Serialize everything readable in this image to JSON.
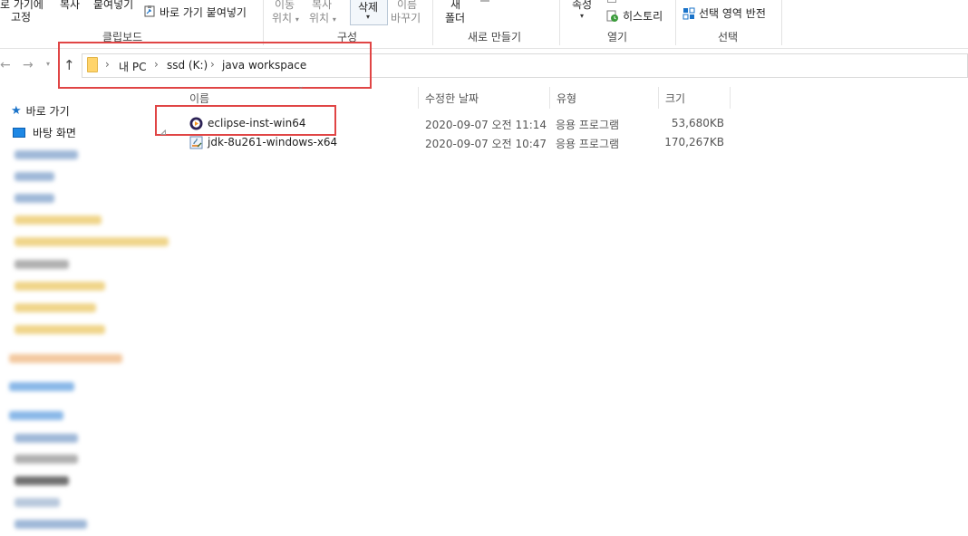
{
  "ribbon": {
    "pin_quick_access_line1": "로 가기에",
    "pin_quick_access_line2": "고정",
    "copy": "복사",
    "paste": "붙여넣기",
    "paste_shortcut": "바로 가기 붙여넣기",
    "move_to_line1": "이동",
    "move_to_line2": "위치",
    "copy_to_line1": "복사",
    "copy_to_line2": "위치",
    "delete": "삭제",
    "rename_line1": "이름",
    "rename_line2": "바꾸기",
    "new_folder_line1": "새",
    "new_folder_line2": "폴더",
    "properties": "속성",
    "history": "히스토리",
    "invert_selection": "선택 영역 반전",
    "group_clipboard": "클립보드",
    "group_organize": "구성",
    "group_new": "새로 만들기",
    "group_open": "열기",
    "group_select": "선택"
  },
  "address": {
    "crumbs": [
      "내 PC",
      "ssd (K:)",
      "java workspace"
    ]
  },
  "navpane": {
    "quick_access": "바로 가기",
    "desktop": "바탕 화면"
  },
  "columns": {
    "name": "이름",
    "date_modified": "수정한 날짜",
    "type": "유형",
    "size": "크기"
  },
  "files": [
    {
      "name": "eclipse-inst-win64",
      "date": "2020-09-07 오전 11:14",
      "type": "응용 프로그램",
      "size": "53,680KB",
      "icon": "eclipse-icon"
    },
    {
      "name": "jdk-8u261-windows-x64",
      "date": "2020-09-07 오전 10:47",
      "type": "응용 프로그램",
      "size": "170,267KB",
      "icon": "java-installer-icon"
    }
  ],
  "colors": {
    "highlight_box": "#e04545",
    "folder": "#ffd46b",
    "accent": "#1a73c9"
  }
}
